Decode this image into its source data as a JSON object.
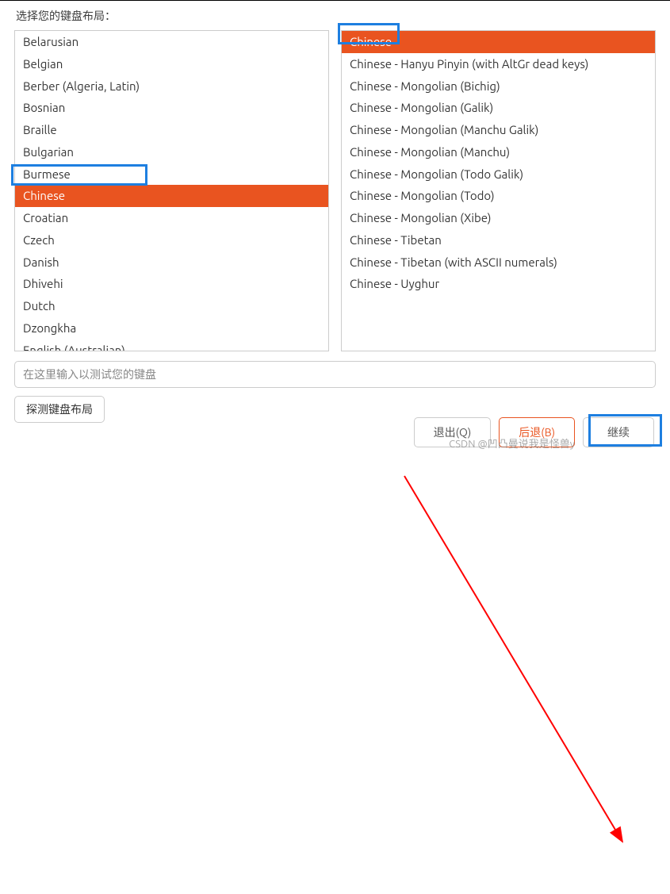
{
  "title": "选择您的键盘布局：",
  "leftList": {
    "items": [
      "Belarusian",
      "Belgian",
      "Berber (Algeria, Latin)",
      "Bosnian",
      "Braille",
      "Bulgarian",
      "Burmese",
      "Chinese",
      "Croatian",
      "Czech",
      "Danish",
      "Dhivehi",
      "Dutch",
      "Dzongkha",
      "English (Australian)"
    ],
    "selectedIndex": 7
  },
  "rightList": {
    "items": [
      "Chinese",
      "Chinese - Hanyu Pinyin (with AltGr dead keys)",
      "Chinese - Mongolian (Bichig)",
      "Chinese - Mongolian (Galik)",
      "Chinese - Mongolian (Manchu Galik)",
      "Chinese - Mongolian (Manchu)",
      "Chinese - Mongolian (Todo Galik)",
      "Chinese - Mongolian (Todo)",
      "Chinese - Mongolian (Xibe)",
      "Chinese - Tibetan",
      "Chinese - Tibetan (with ASCII numerals)",
      "Chinese - Uyghur"
    ],
    "selectedIndex": 0
  },
  "testInput": {
    "placeholder": "在这里输入以测试您的键盘"
  },
  "detectButton": "探测键盘布局",
  "quitButton": "退出(Q)",
  "backButton": "后退(B)",
  "continueButton": "继续",
  "watermark": "CSDN @凹凸曼说我是怪兽y"
}
